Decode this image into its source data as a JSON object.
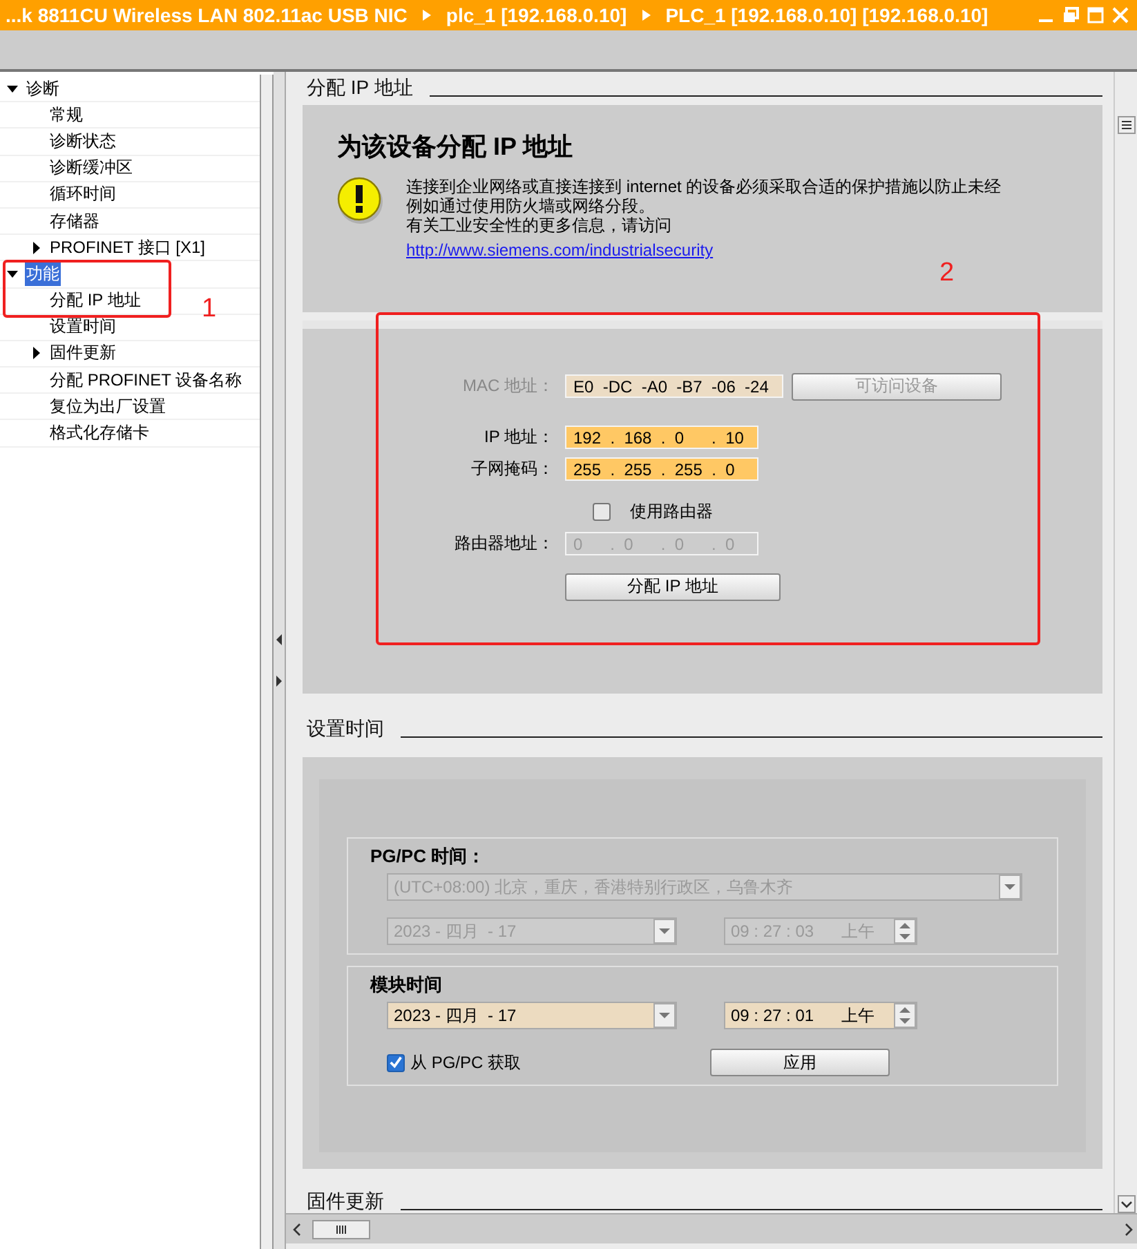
{
  "title_bar": {
    "breadcrumb": [
      "...k 8811CU Wireless LAN 802.11ac USB NIC",
      "plc_1 [192.168.0.10]",
      "PLC_1 [192.168.0.10] [192.168.0.10]"
    ]
  },
  "tree": [
    {
      "label": "诊断",
      "expanded": true,
      "selected": false,
      "children": [
        {
          "label": "常规",
          "selected": false
        },
        {
          "label": "诊断状态",
          "selected": false
        },
        {
          "label": "诊断缓冲区",
          "selected": false
        },
        {
          "label": "循环时间",
          "selected": false
        },
        {
          "label": "存储器",
          "selected": false
        },
        {
          "label": "PROFINET 接口 [X1]",
          "expanded": false,
          "selected": false
        }
      ]
    },
    {
      "label": "功能",
      "expanded": true,
      "selected": true,
      "children": [
        {
          "label": "分配 IP 地址",
          "selected": false
        },
        {
          "label": "设置时间",
          "selected": false
        },
        {
          "label": "固件更新",
          "expanded": false,
          "selected": false
        },
        {
          "label": "分配 PROFINET 设备名称",
          "selected": false
        },
        {
          "label": "复位为出厂设置",
          "selected": false
        },
        {
          "label": "格式化存储卡",
          "selected": false
        }
      ]
    }
  ],
  "assign_ip": {
    "section_title": "分配 IP 地址",
    "heading": "为该设备分配 IP 地址",
    "warning": [
      "连接到企业网络或直接连接到 internet 的设备必须采取合适的保护措施以防止未经",
      "例如通过使用防火墙或网络分段。",
      "有关工业安全性的更多信息，请访问"
    ],
    "link": "http://www.siemens.com/industrialsecurity",
    "fields": [
      {
        "kind": "mac",
        "label": "MAC 地址：",
        "value": "E0  -DC  -A0  -B7  -06  -24"
      },
      {
        "kind": "ip",
        "label": "IP 地址：",
        "value": "192  .  168  .  0      .  10",
        "disabled": false
      },
      {
        "kind": "ip",
        "label": "子网掩码：",
        "value": "255  .  255  .  255  .  0",
        "disabled": false
      },
      {
        "kind": "checkbox",
        "label": "使用路由器",
        "checked": false
      },
      {
        "kind": "ip",
        "label": "路由器地址：",
        "value": "0      .  0      .  0      .  0",
        "disabled": true
      }
    ],
    "accessible_button": {
      "label": "可访问设备",
      "disabled": true
    },
    "assign_button": {
      "label": "分配 IP 地址",
      "disabled": false
    }
  },
  "set_time": {
    "section_title": "设置时间",
    "groups": [
      {
        "title": "PG/PC 时间：",
        "timezone": "(UTC+08:00) 北京，重庆，香港特别行政区，乌鲁木齐",
        "date": "2023 - 四月  - 17",
        "time": "09 : 27 : 03",
        "ampm": "上午",
        "disabled": true
      },
      {
        "title": "模块时间",
        "date": "2023 - 四月  - 17",
        "time": "09 : 27 : 01",
        "ampm": "上午",
        "disabled": false,
        "from_pgpc": {
          "label": "从 PG/PC 获取",
          "checked": true
        },
        "apply_button": "应用"
      }
    ]
  },
  "firmware": {
    "section_title": "固件更新"
  },
  "annotations": [
    {
      "label": "1"
    },
    {
      "label": "2"
    }
  ]
}
